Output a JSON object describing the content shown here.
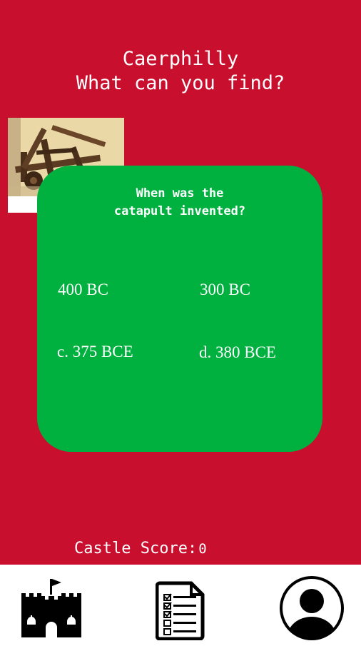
{
  "header": {
    "line1": "Caerphilly",
    "line2": "What can you find?"
  },
  "image": {
    "icon": "catapult-photo"
  },
  "quiz": {
    "question_line1": "When was the",
    "question_line2": "catapult invented?",
    "answers": [
      {
        "label": "400 BC"
      },
      {
        "label": "300 BC"
      },
      {
        "label": "c. 375 BCE"
      },
      {
        "label": "d. 380 BCE"
      }
    ]
  },
  "score": {
    "label": "Castle Score:",
    "value": "0"
  },
  "nav": {
    "items": [
      {
        "icon": "castle-icon"
      },
      {
        "icon": "checklist-icon"
      },
      {
        "icon": "profile-icon"
      }
    ]
  },
  "colors": {
    "background": "#c8102e",
    "card": "#00b140",
    "text": "#ffffff",
    "navbar": "#ffffff"
  }
}
